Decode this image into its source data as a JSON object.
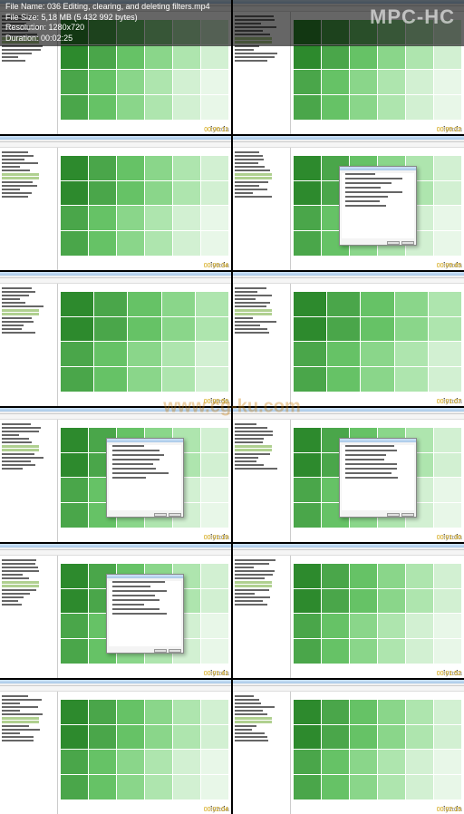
{
  "player": {
    "logo": "MPC-HC",
    "info": {
      "file_name_label": "File Name:",
      "file_name": "036 Editing, clearing, and deleting filters.mp4",
      "file_size_label": "File Size:",
      "file_size": "5,18 MB (5 432 992 bytes)",
      "resolution_label": "Resolution:",
      "resolution": "1280x720",
      "duration_label": "Duration:",
      "duration": "00:02:25"
    }
  },
  "watermark": "www.cg-ku.com",
  "thumbnails": [
    {
      "timestamp": "00:00:11",
      "brand": "lynda",
      "dialog": false,
      "treemap_cols": 6
    },
    {
      "timestamp": "00:00:22",
      "brand": "lynda",
      "dialog": false,
      "treemap_cols": 6
    },
    {
      "timestamp": "00:00:34",
      "brand": "lynda",
      "dialog": false,
      "treemap_cols": 6
    },
    {
      "timestamp": "00:00:45",
      "brand": "lynda",
      "dialog": true,
      "treemap_cols": 6
    },
    {
      "timestamp": "00:00:56",
      "brand": "lynda",
      "dialog": false,
      "treemap_cols": 5
    },
    {
      "timestamp": "00:01:07",
      "brand": "lynda",
      "dialog": false,
      "treemap_cols": 5
    },
    {
      "timestamp": "00:01:19",
      "brand": "lynda",
      "dialog": true,
      "treemap_cols": 6
    },
    {
      "timestamp": "00:01:30",
      "brand": "lynda",
      "dialog": true,
      "treemap_cols": 6
    },
    {
      "timestamp": "00:01:41",
      "brand": "lynda",
      "dialog": true,
      "treemap_cols": 6
    },
    {
      "timestamp": "00:01:52",
      "brand": "lynda",
      "dialog": false,
      "treemap_cols": 6
    },
    {
      "timestamp": "00:02:04",
      "brand": "lynda",
      "dialog": false,
      "treemap_cols": 6
    },
    {
      "timestamp": "00:02:15",
      "brand": "lynda",
      "dialog": false,
      "treemap_cols": 6
    }
  ],
  "treemap_palette": [
    "g1",
    "g2",
    "g3",
    "g4",
    "g5",
    "g6",
    "g7"
  ]
}
